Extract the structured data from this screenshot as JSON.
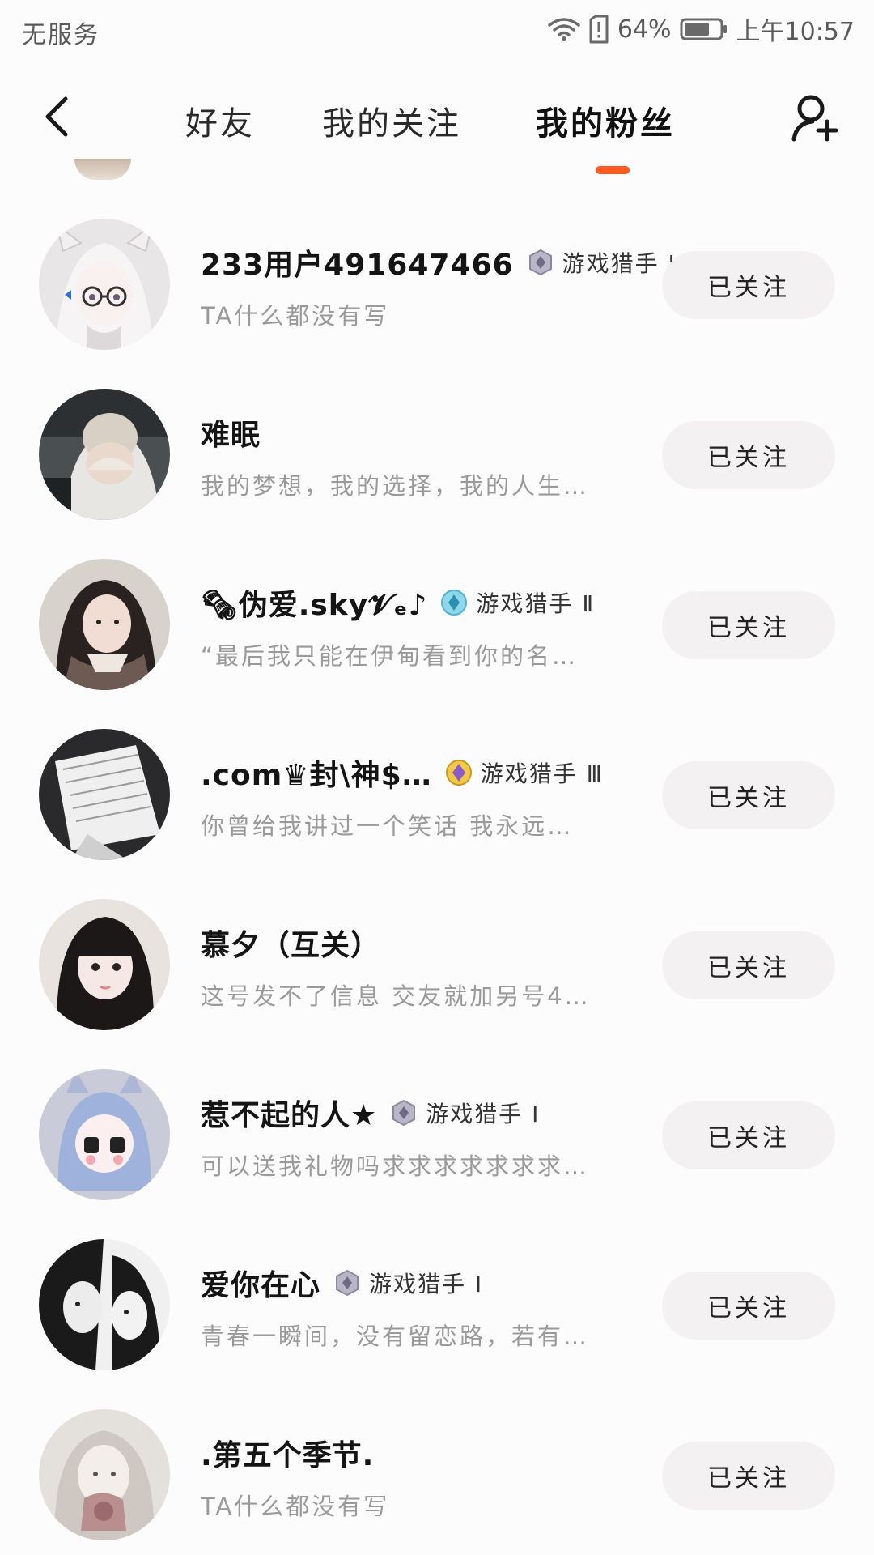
{
  "status_bar": {
    "carrier": "无服务",
    "battery": "64%",
    "time": "上午10:57"
  },
  "header": {
    "tabs": [
      {
        "label": "好友"
      },
      {
        "label": "我的关注"
      },
      {
        "label": "我的粉丝"
      }
    ],
    "active_tab": "我的粉丝",
    "accent_color": "#ff5a1f"
  },
  "fans": [
    {
      "name": "233用户491647466",
      "badge": "游戏猎手 Ⅰ",
      "bio": "TA什么都没有写",
      "follow_label": "已关注"
    },
    {
      "name": "难眠",
      "badge": "",
      "bio": "我的梦想，我的选择，我的人生…",
      "follow_label": "已关注"
    },
    {
      "name": "🗞伪爱.sky𝓥ₑ♪",
      "badge": "游戏猎手 Ⅱ",
      "bio": "“最后我只能在伊甸看到你的名…",
      "follow_label": "已关注"
    },
    {
      "name": ".com♛封\\神$…",
      "badge": "游戏猎手 Ⅲ",
      "bio": "你曾给我讲过一个笑话 我永远…",
      "follow_label": "已关注"
    },
    {
      "name": "慕夕（互关）",
      "badge": "",
      "bio": "这号发不了信息 交友就加另号4…",
      "follow_label": "已关注"
    },
    {
      "name": "惹不起的人★",
      "badge": "游戏猎手 Ⅰ",
      "bio": "可以送我礼物吗求求求求求求求…",
      "follow_label": "已关注"
    },
    {
      "name": "爱你在心",
      "badge": "游戏猎手 Ⅰ",
      "bio": "青春一瞬间，没有留恋路，若有…",
      "follow_label": "已关注"
    },
    {
      "name": ".第五个季节.",
      "badge": "",
      "bio": "TA什么都没有写",
      "follow_label": "已关注"
    }
  ]
}
